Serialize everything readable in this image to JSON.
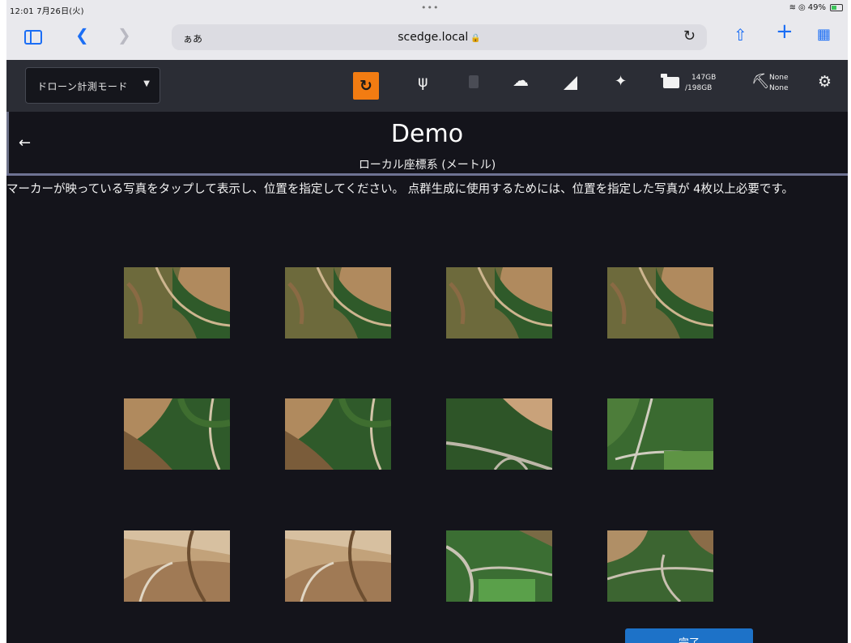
{
  "status_bar": {
    "time": "12:01 7月26日(火)",
    "battery": "49%"
  },
  "browser": {
    "text_size": "ぁあ",
    "url": "scedge.local"
  },
  "header": {
    "mode_label": "ドローン計測モード",
    "storage_used": "147GB",
    "storage_total": "/198GB",
    "power_line1": "None",
    "power_line2": "None"
  },
  "page": {
    "title": "Demo",
    "subtitle": "ローカル座標系 (メートル)",
    "instruction": "マーカーが映っている写真をタップして表示し、位置を指定してください。 点群生成に使用するためには、位置を指定した写真が 4枚以上必要です。"
  },
  "photos": [
    {
      "variant": "a"
    },
    {
      "variant": "a"
    },
    {
      "variant": "a"
    },
    {
      "variant": "a"
    },
    {
      "variant": "b"
    },
    {
      "variant": "b"
    },
    {
      "variant": "c"
    },
    {
      "variant": "d"
    },
    {
      "variant": "e"
    },
    {
      "variant": "e"
    },
    {
      "variant": "f"
    },
    {
      "variant": "g"
    }
  ],
  "colors": {
    "accent_orange": "#f27c12",
    "primary_button": "#1d72c8",
    "background": "#14141b",
    "header": "#2b2d35"
  },
  "icons": [
    "sidebar-icon",
    "chevron-left-icon",
    "chevron-right-icon",
    "lock-icon",
    "reload-icon",
    "share-icon",
    "plus-icon",
    "tabs-grid-icon",
    "alert-sync-icon",
    "usb-icon",
    "sd-card-icon",
    "cloud-icon",
    "signal-icon",
    "satellite-icon",
    "folder-icon",
    "plug-icon",
    "gear-icon",
    "arrow-left-icon"
  ]
}
